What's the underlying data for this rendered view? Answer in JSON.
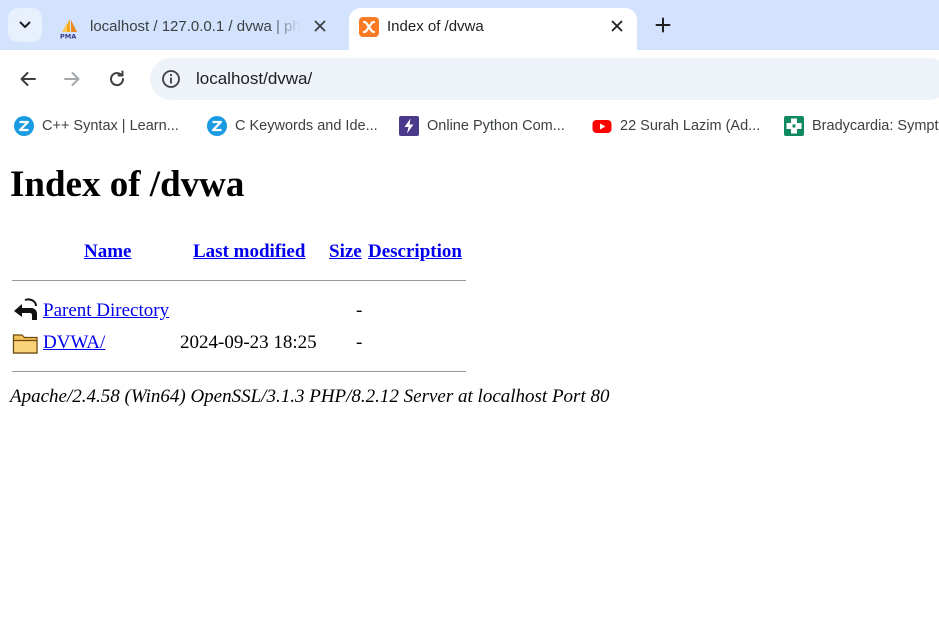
{
  "tabs": [
    {
      "title": "localhost / 127.0.0.1 / dvwa | phpMyAdmin",
      "favicon": "pma-sail-icon",
      "active": false
    },
    {
      "title": "Index of /dvwa",
      "favicon": "xampp-icon",
      "active": true
    }
  ],
  "toolbar": {
    "url": "localhost/dvwa/"
  },
  "bookmarks": [
    {
      "label": "C++ Syntax | Learn...",
      "icon": "z-logo-icon"
    },
    {
      "label": "C Keywords and Ide...",
      "icon": "z-logo-icon"
    },
    {
      "label": "Online Python Com...",
      "icon": "bolt-icon"
    },
    {
      "label": "22 Surah Lazim (Ad...",
      "icon": "youtube-icon"
    },
    {
      "label": "Bradycardia: Sympt...",
      "icon": "plus-cross-icon"
    }
  ],
  "page": {
    "heading": "Index of /dvwa",
    "columns": {
      "name": "Name",
      "last_modified": "Last modified",
      "size": "Size",
      "description": "Description"
    },
    "entries": [
      {
        "name": "Parent Directory",
        "last_modified": "",
        "size": "-",
        "description": "",
        "icon": "back-arrow-icon"
      },
      {
        "name": "DVWA/",
        "last_modified": "2024-09-23 18:25",
        "size": "-",
        "description": "",
        "icon": "folder-icon"
      }
    ],
    "footer": "Apache/2.4.58 (Win64) OpenSSL/3.1.3 PHP/8.2.12 Server at localhost Port 80"
  },
  "colors": {
    "tabstrip": "#d3e3fd",
    "link": "#0000ee",
    "omnibox": "#eef2f9"
  }
}
